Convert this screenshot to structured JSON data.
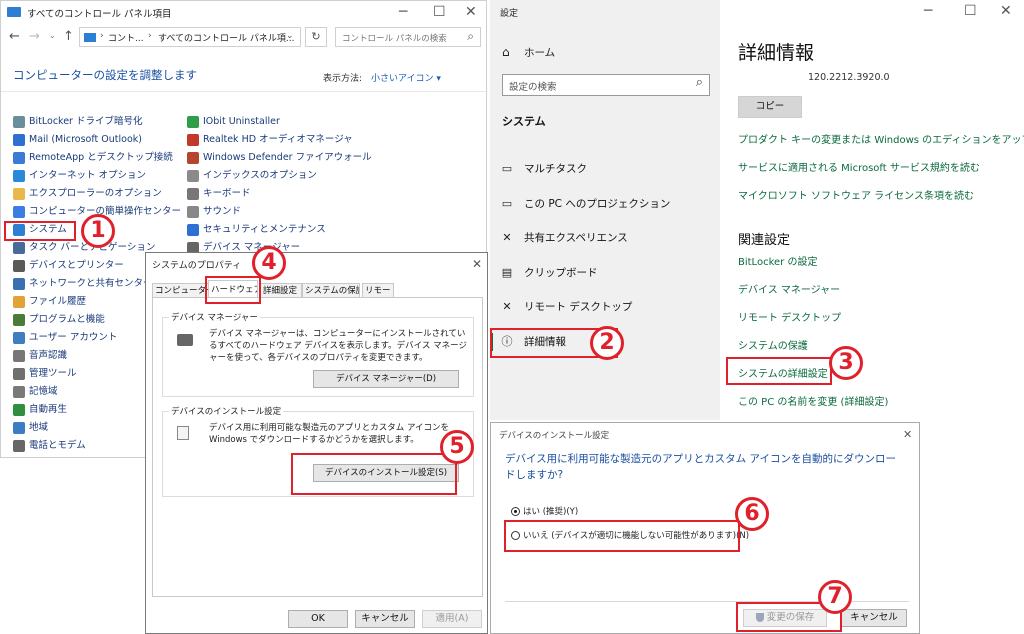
{
  "control_panel": {
    "title": "すべてのコントロール パネル項目",
    "path_prefix": "コント...",
    "path_current": "すべてのコントロール パネル項...",
    "search_placeholder": "コントロール パネルの検索",
    "heading": "コンピューターの設定を調整します",
    "view_label": "表示方法:",
    "view_value": "小さいアイコン ▾",
    "left_items": [
      {
        "label": "BitLocker ドライブ暗号化",
        "color": "#6b8e9f"
      },
      {
        "label": "Mail (Microsoft Outlook)",
        "color": "#2f6fd1"
      },
      {
        "label": "RemoteApp とデスクトップ接続",
        "color": "#3a7bd5"
      },
      {
        "label": "インターネット オプション",
        "color": "#2b89d9"
      },
      {
        "label": "エクスプローラーのオプション",
        "color": "#e8b84a"
      },
      {
        "label": "コンピューターの簡単操作センター",
        "color": "#3b7de0"
      },
      {
        "label": "システム",
        "color": "#2d7fd3"
      },
      {
        "label": "タスク バーとナビゲーション",
        "color": "#4a6b9a"
      },
      {
        "label": "デバイスとプリンター",
        "color": "#5a5a5a"
      },
      {
        "label": "ネットワークと共有センター",
        "color": "#3a6fb0"
      },
      {
        "label": "ファイル履歴",
        "color": "#e2a23a"
      },
      {
        "label": "プログラムと機能",
        "color": "#4b7c3a"
      },
      {
        "label": "ユーザー アカウント",
        "color": "#3f7fbf"
      },
      {
        "label": "音声認識",
        "color": "#777777"
      },
      {
        "label": "管理ツール",
        "color": "#6f6f6f"
      },
      {
        "label": "記憶域",
        "color": "#7a7a7a"
      },
      {
        "label": "自動再生",
        "color": "#2f8f3f"
      },
      {
        "label": "地域",
        "color": "#3c7cc4"
      },
      {
        "label": "電話とモデム",
        "color": "#666666"
      }
    ],
    "right_items": [
      {
        "label": "IObit Uninstaller",
        "color": "#2f9d4a"
      },
      {
        "label": "Realtek HD オーディオマネージャ",
        "color": "#c0392b"
      },
      {
        "label": "Windows Defender ファイアウォール",
        "color": "#b5452f"
      },
      {
        "label": "インデックスのオプション",
        "color": "#8a8a8a"
      },
      {
        "label": "キーボード",
        "color": "#777777"
      },
      {
        "label": "サウンド",
        "color": "#888888"
      },
      {
        "label": "セキュリティとメンテナンス",
        "color": "#2f6fd1"
      },
      {
        "label": "デバイス マネージャー",
        "color": "#666666"
      }
    ]
  },
  "settings": {
    "title": "設定",
    "home": "ホーム",
    "search_placeholder": "設定の検索",
    "section": "システム",
    "nav": [
      {
        "label": "マルチタスク",
        "icon": "▭"
      },
      {
        "label": "この PC へのプロジェクション",
        "icon": "▭"
      },
      {
        "label": "共有エクスペリエンス",
        "icon": "✕"
      },
      {
        "label": "クリップボード",
        "icon": "▤"
      },
      {
        "label": "リモート デスクトップ",
        "icon": "✕"
      },
      {
        "label": "詳細情報",
        "icon": "ⓘ"
      }
    ],
    "info_heading": "詳細情報",
    "version": "120.2212.3920.0",
    "copy_button": "コピー",
    "links": [
      "プロダクト キーの変更または Windows のエディションをアップグレード",
      "サービスに適用される Microsoft サービス規約を読む",
      "マイクロソフト ソフトウェア ライセンス条項を読む"
    ],
    "related_heading": "関連設定",
    "related_links": [
      "BitLocker の設定",
      "デバイス マネージャー",
      "リモート デスクトップ",
      "システムの保護",
      "システムの詳細設定",
      "この PC の名前を変更 (詳細設定)"
    ]
  },
  "sysprops": {
    "title": "システムのプロパティ",
    "tabs": [
      "コンピューター名",
      "ハードウェア",
      "詳細設定",
      "システムの保護",
      "リモート"
    ],
    "group1_title": "デバイス マネージャー",
    "group1_text": "デバイス マネージャーは、コンピューターにインストールされているすべてのハードウェア デバイスを表示します。デバイス マネージャーを使って、各デバイスのプロパティを変更できます。",
    "group1_button": "デバイス マネージャー(D)",
    "group2_title": "デバイスのインストール設定",
    "group2_text": "デバイス用に利用可能な製造元のアプリとカスタム アイコンを Windows でダウンロードするかどうかを選択します。",
    "group2_button": "デバイスのインストール設定(S)",
    "ok": "OK",
    "cancel": "キャンセル",
    "apply": "適用(A)"
  },
  "install_dialog": {
    "title": "デバイスのインストール設定",
    "question": "デバイス用に利用可能な製造元のアプリとカスタム アイコンを自動的にダウンロードしますか?",
    "yes": "はい (推奨)(Y)",
    "no": "いいえ (デバイスが適切に機能しない可能性があります)(N)",
    "save": "変更の保存",
    "cancel": "キャンセル"
  },
  "steps": [
    "1",
    "2",
    "3",
    "4",
    "5",
    "6",
    "7"
  ]
}
